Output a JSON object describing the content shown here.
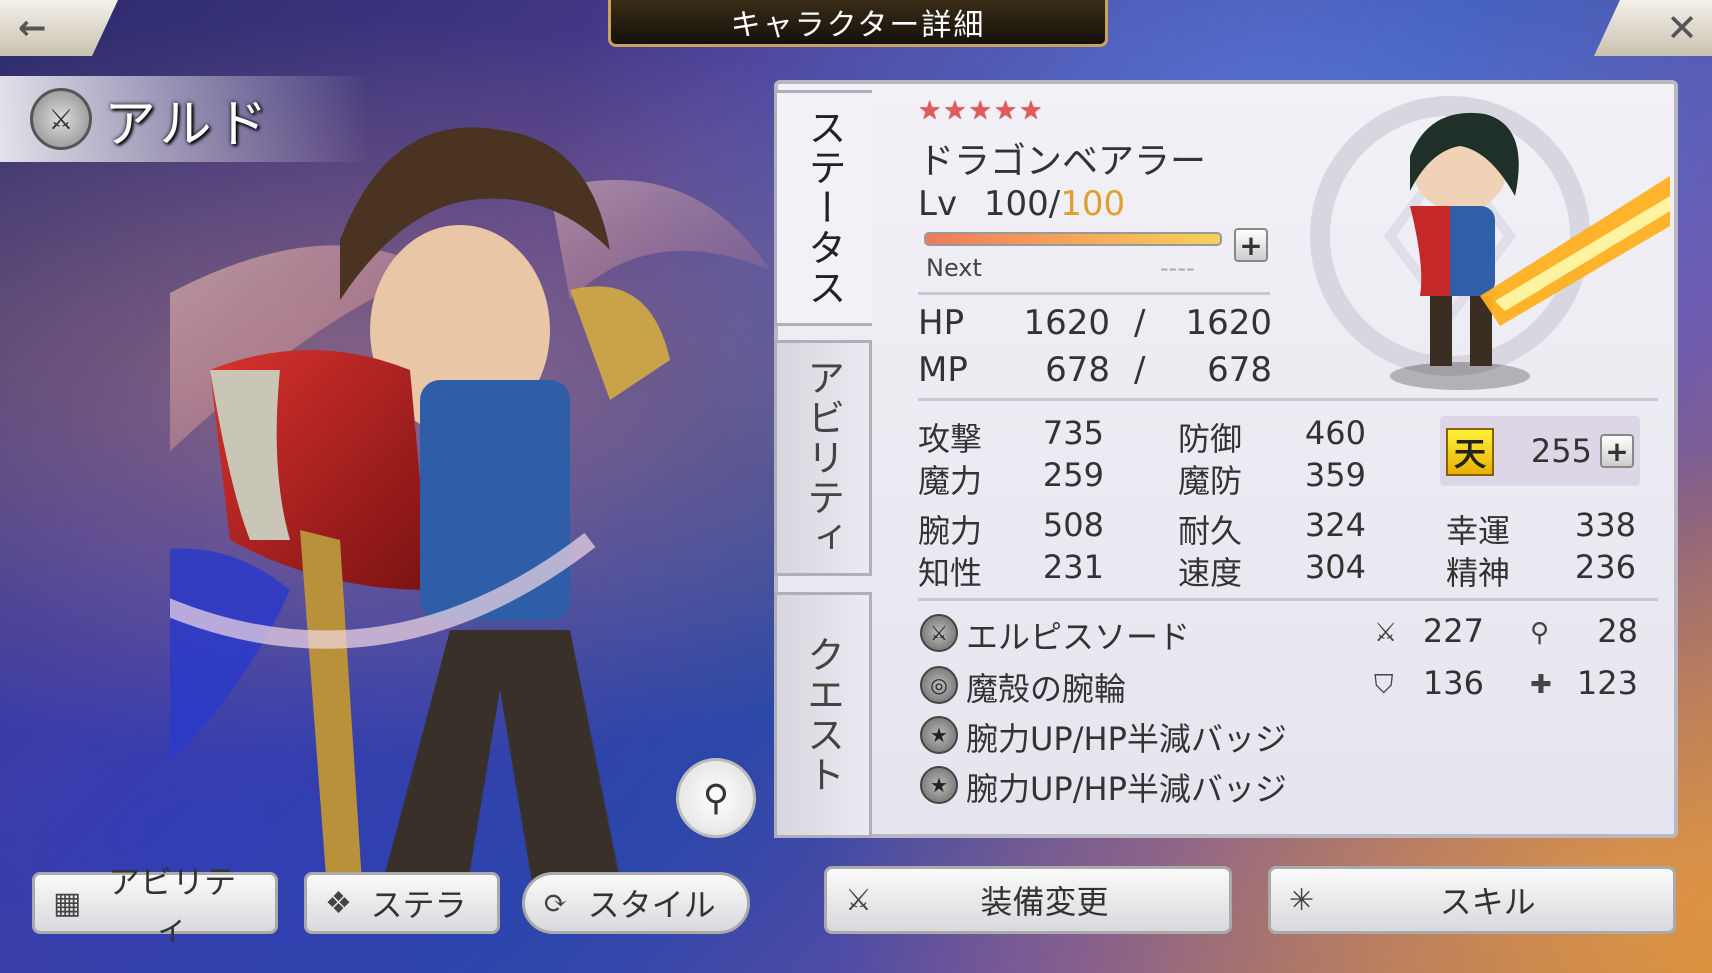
{
  "header": {
    "title": "キャラクター詳細",
    "back_glyph": "←",
    "close_glyph": "✕"
  },
  "character": {
    "name": "アルド",
    "weapon_icon": "sword-icon"
  },
  "tabs": [
    {
      "label": "ステータス",
      "active": true
    },
    {
      "label": "アビリティ",
      "active": false
    },
    {
      "label": "クエスト",
      "active": false
    }
  ],
  "status": {
    "stars": "★★★★★",
    "rarity": 5,
    "job": "ドラゴンベアラー",
    "lv_label": "Lv",
    "level": "100/",
    "level_max": "100",
    "exp_progress": 1.0,
    "next_label": "Next",
    "next_value": "----",
    "hp_label": "HP",
    "hp": "1620",
    "hp_sep": "/",
    "hp_max": "1620",
    "mp_label": "MP",
    "mp": "678",
    "mp_sep": "/",
    "mp_max": "678",
    "attack_label": "攻撃",
    "attack": "735",
    "defense_label": "防御",
    "defense": "460",
    "magic_label": "魔力",
    "magic": "259",
    "mdef_label": "魔防",
    "mdef": "359",
    "ten_label": "天",
    "ten": "255",
    "str_label": "腕力",
    "str": "508",
    "end_label": "耐久",
    "end": "324",
    "luck_label": "幸運",
    "luck": "338",
    "int_label": "知性",
    "int": "231",
    "spd_label": "速度",
    "spd": "304",
    "spirit_label": "精神",
    "spirit": "236"
  },
  "equipment": [
    {
      "name": "エルピスソード",
      "icon": "sword-icon",
      "stat1_icon": "sword-icon",
      "stat1": "227",
      "stat2_icon": "wand-icon",
      "stat2": "28"
    },
    {
      "name": "魔殻の腕輪",
      "icon": "bracelet-icon",
      "stat1_icon": "shield-icon",
      "stat1": "136",
      "stat2_icon": "cross-shield-icon",
      "stat2": "123"
    },
    {
      "name": "腕力UP/HP半減バッジ",
      "icon": "star-badge-icon"
    },
    {
      "name": "腕力UP/HP半減バッジ",
      "icon": "star-badge-icon"
    }
  ],
  "buttons": {
    "ability": "アビリティ",
    "stella": "ステラ",
    "style": "スタイル",
    "equip_change": "装備変更",
    "skill": "スキル"
  },
  "colors": {
    "star": "#e05a5a",
    "level_max": "#e0a030",
    "panel_bg": "#f2f1f6"
  }
}
